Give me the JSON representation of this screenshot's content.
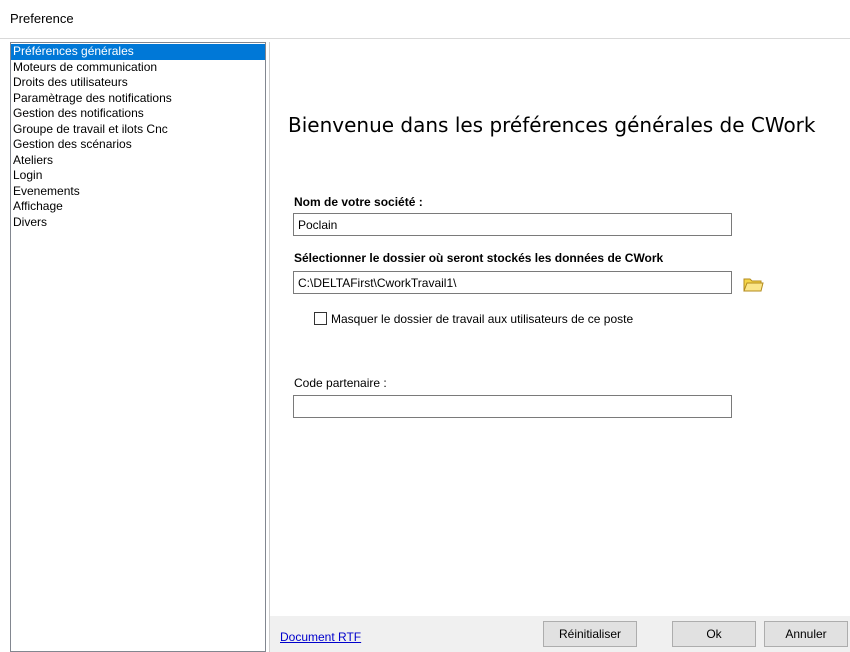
{
  "window": {
    "title": "Preference"
  },
  "sidebar": {
    "items": [
      {
        "label": "Préférences générales",
        "selected": true
      },
      {
        "label": "Moteurs de communication"
      },
      {
        "label": "Droits des utilisateurs"
      },
      {
        "label": "Paramètrage des notifications"
      },
      {
        "label": "Gestion des notifications"
      },
      {
        "label": "Groupe de travail et ilots Cnc"
      },
      {
        "label": "Gestion des scénarios"
      },
      {
        "label": "Ateliers"
      },
      {
        "label": "Login"
      },
      {
        "label": "Evenements"
      },
      {
        "label": "Affichage"
      },
      {
        "label": "Divers"
      }
    ]
  },
  "main": {
    "welcome": "Bienvenue dans les préférences générales de CWork",
    "company_label": "Nom de votre société :",
    "company_value": "Poclain",
    "folder_label": "Sélectionner le dossier où seront stockés les données de CWork",
    "folder_value": "C:\\DELTAFirst\\CworkTravail1\\",
    "hide_folder_label": "Masquer le dossier de travail aux utilisateurs de ce poste",
    "hide_folder_checked": false,
    "partner_label": "Code partenaire :",
    "partner_value": ""
  },
  "footer": {
    "link": "Document RTF",
    "reset": "Réinitialiser",
    "ok": "Ok",
    "cancel": "Annuler"
  },
  "colors": {
    "selection": "#0078d7",
    "link": "#0000cc",
    "footer_bg": "#f0f0f0",
    "folder_icon": "#f5d547"
  }
}
